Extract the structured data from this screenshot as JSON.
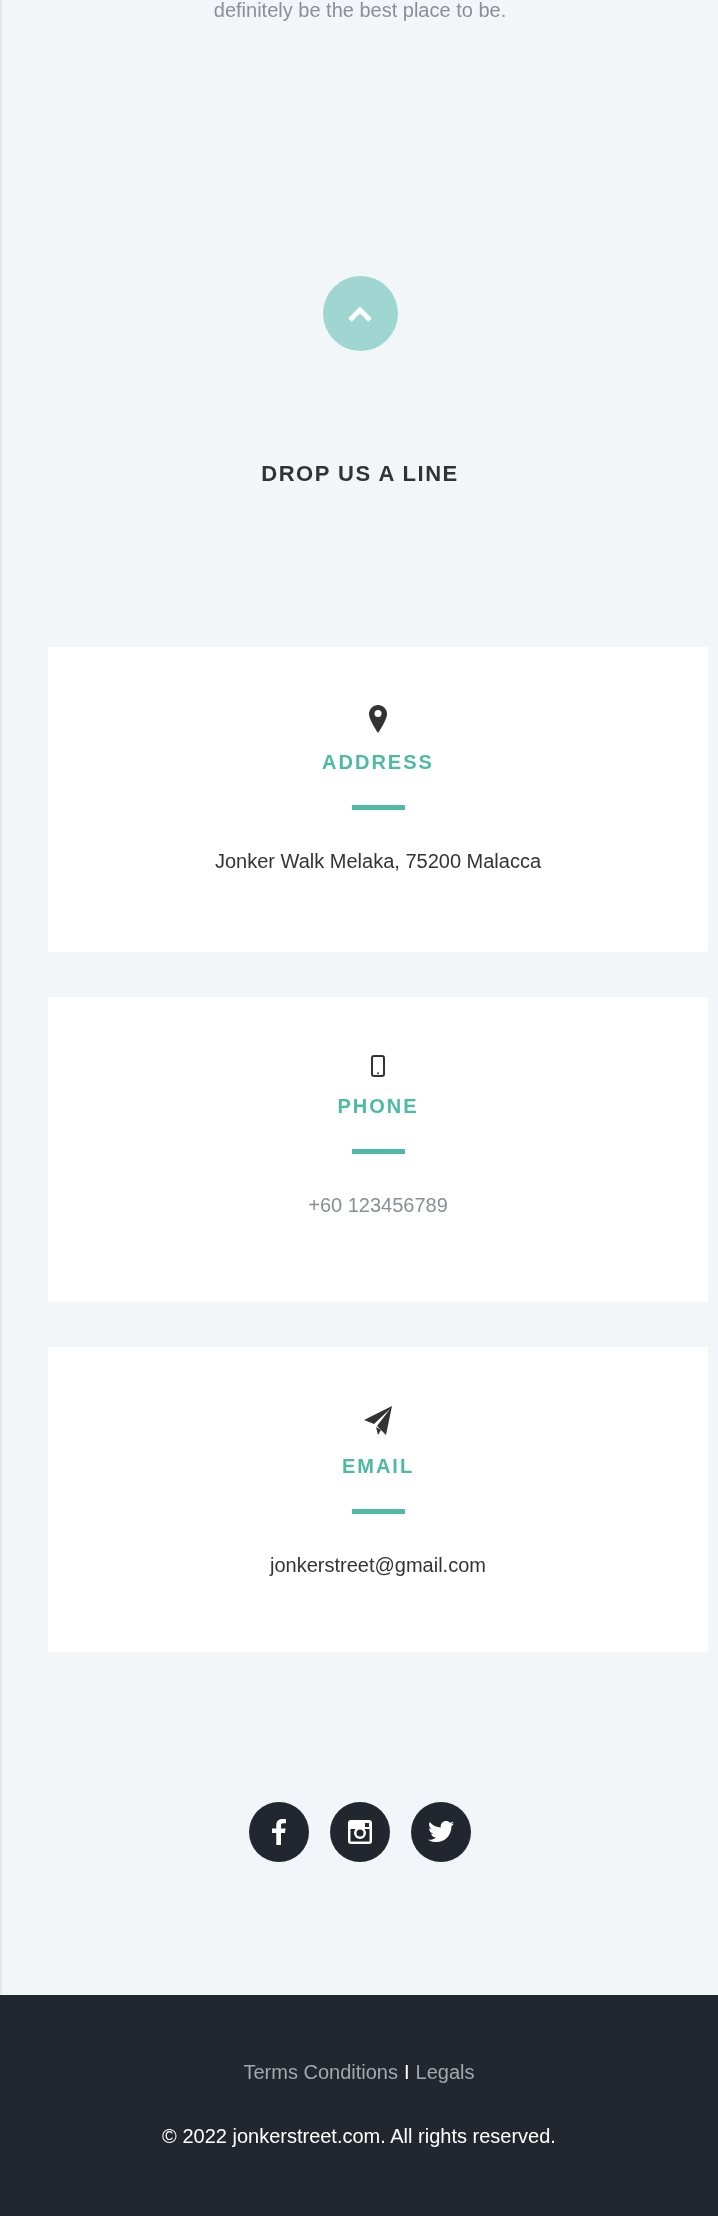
{
  "intro_text": "definitely be the best place to be.",
  "heading": "DROP US A LINE",
  "contact_cards": [
    {
      "kind": "address",
      "title": "ADDRESS",
      "value": "Jonker Walk Melaka, 75200 Malacca",
      "muted": false
    },
    {
      "kind": "phone",
      "title": "PHONE",
      "value": "+60 123456789",
      "muted": true
    },
    {
      "kind": "email",
      "title": "EMAIL",
      "value": "jonkerstreet@gmail.com",
      "muted": false
    }
  ],
  "social_links": [
    {
      "kind": "facebook"
    },
    {
      "kind": "instagram"
    },
    {
      "kind": "twitter"
    }
  ],
  "footer": {
    "links": [
      "Terms Conditions",
      "Legals"
    ],
    "separator": "I",
    "copyright": "© 2022 jonkerstreet.com. All rights reserved."
  }
}
